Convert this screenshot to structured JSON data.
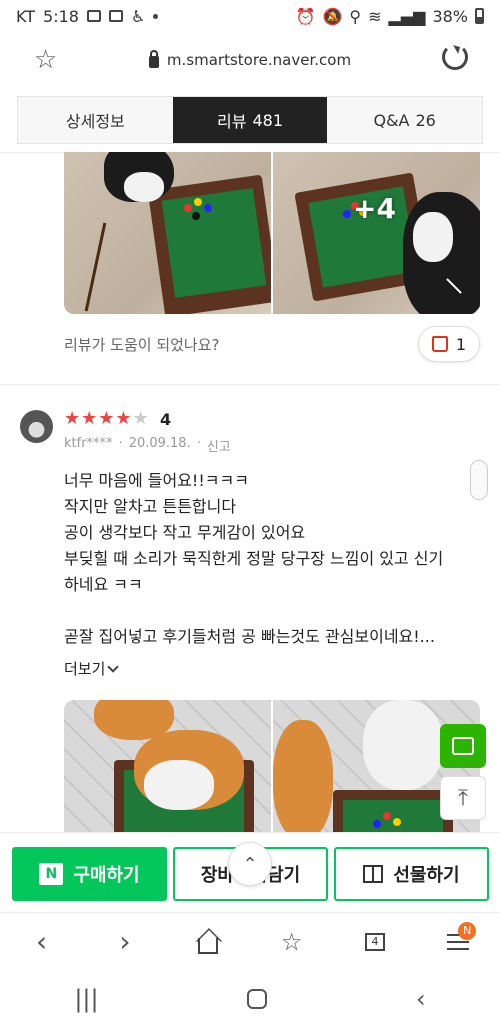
{
  "status_bar": {
    "carrier": "KT",
    "time": "5:18",
    "battery": "38%"
  },
  "address_bar": {
    "url": "m.smartstore.naver.com"
  },
  "tabs": [
    {
      "label": "상세정보",
      "count": ""
    },
    {
      "label": "리뷰",
      "count": "481"
    },
    {
      "label": "Q&A",
      "count": "26"
    }
  ],
  "active_tab": "리뷰",
  "previous_review": {
    "more_photos": "+4",
    "helpful_question": "리뷰가 도움이 되었나요?",
    "helpful_count": "1"
  },
  "review": {
    "rating": 4,
    "rating_max": 5,
    "rating_text": "4",
    "user": "ktfr****",
    "date": "20.09.18.",
    "report": "신고",
    "body_lines": [
      "너무 마음에 들어요!!ㅋㅋㅋ",
      "작지만 알차고 튼튼합니다",
      "공이 생각보다 작고 무게감이 있어요",
      "부딪힐 때 소리가 묵직한게 정말 당구장 느낌이 있고 신기",
      "하네요 ㅋㅋ",
      "",
      "곧잘 집어넣고 후기들처럼 공 빠는것도 관심보이네요!..."
    ],
    "more_label": "더보기"
  },
  "actions": {
    "buy": "구매하기",
    "npay": "N",
    "cart": "장바구니담기",
    "gift": "선물하기"
  },
  "browser_nav": {
    "tab_count": "4",
    "menu_badge": "N"
  },
  "colors": {
    "accent_green": "#03c75a",
    "star_red": "#f04343",
    "active_tab_bg": "#222222"
  }
}
